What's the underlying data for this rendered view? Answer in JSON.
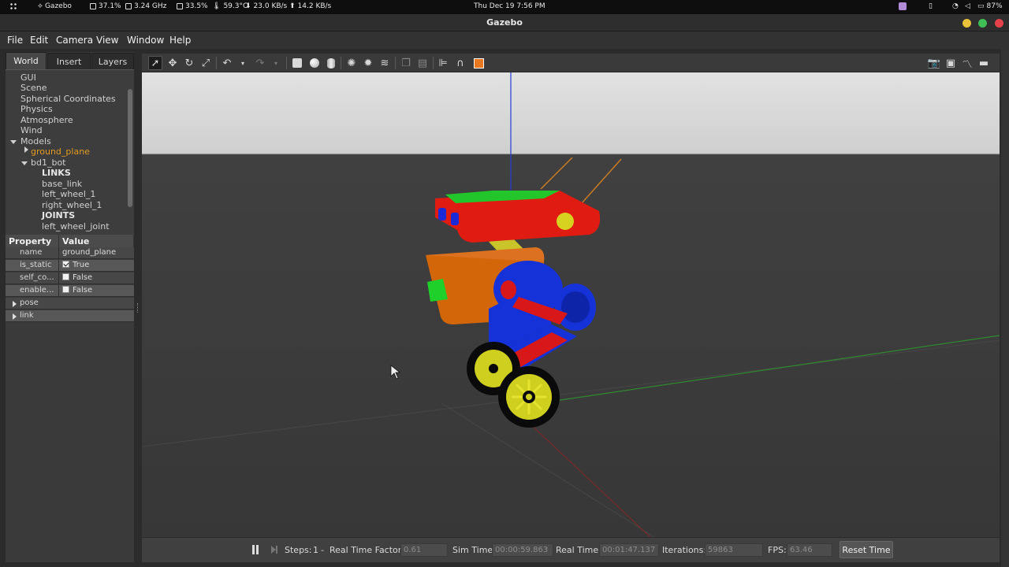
{
  "system_bar": {
    "app": "Gazebo",
    "cpu": "37.1%",
    "freq": "3.24 GHz",
    "mem": "33.5%",
    "temp": "59.3°C",
    "down": "23.0 KB/s",
    "up": "14.2 KB/s",
    "clock": "Thu Dec 19  7:56 PM",
    "battery": "87%"
  },
  "window": {
    "title": "Gazebo",
    "button_colors": {
      "minimize": "#e8c33a",
      "maximize": "#3fbf55",
      "close": "#e6404a"
    }
  },
  "menu": [
    "File",
    "Edit",
    "Camera",
    "View",
    "Window",
    "Help"
  ],
  "left_panel": {
    "tabs": [
      "World",
      "Insert",
      "Layers"
    ],
    "active_tab": "World",
    "tree": {
      "gui": "GUI",
      "scene": "Scene",
      "spherical": "Spherical Coordinates",
      "physics": "Physics",
      "atmosphere": "Atmosphere",
      "wind": "Wind",
      "models": "Models",
      "ground_plane": "ground_plane",
      "bd1_bot": "bd1_bot",
      "links": "LINKS",
      "base_link": "base_link",
      "left_wheel_1": "left_wheel_1",
      "right_wheel_1": "right_wheel_1",
      "joints": "JOINTS",
      "left_wheel_joint": "left_wheel_joint"
    },
    "properties": {
      "header_property": "Property",
      "header_value": "Value",
      "rows": [
        {
          "key": "name",
          "value": "ground_plane"
        },
        {
          "key": "is_static",
          "value": "True",
          "checked": true
        },
        {
          "key": "self_co...",
          "value": "False",
          "checked": false
        },
        {
          "key": "enable...",
          "value": "False",
          "checked": false
        }
      ],
      "pose": "pose",
      "link": "link"
    }
  },
  "bottom_bar": {
    "steps_label": "Steps:",
    "steps_value": "1",
    "rtf_label": "Real Time Factor:",
    "rtf_value": "0.61",
    "sim_time_label": "Sim Time:",
    "sim_time_value": "00:00:59.863",
    "real_time_label": "Real Time:",
    "real_time_value": "00:01:47.137",
    "iterations_label": "Iterations:",
    "iterations_value": "59863",
    "fps_label": "FPS:",
    "fps_value": "63.46",
    "reset_time": "Reset Time"
  }
}
